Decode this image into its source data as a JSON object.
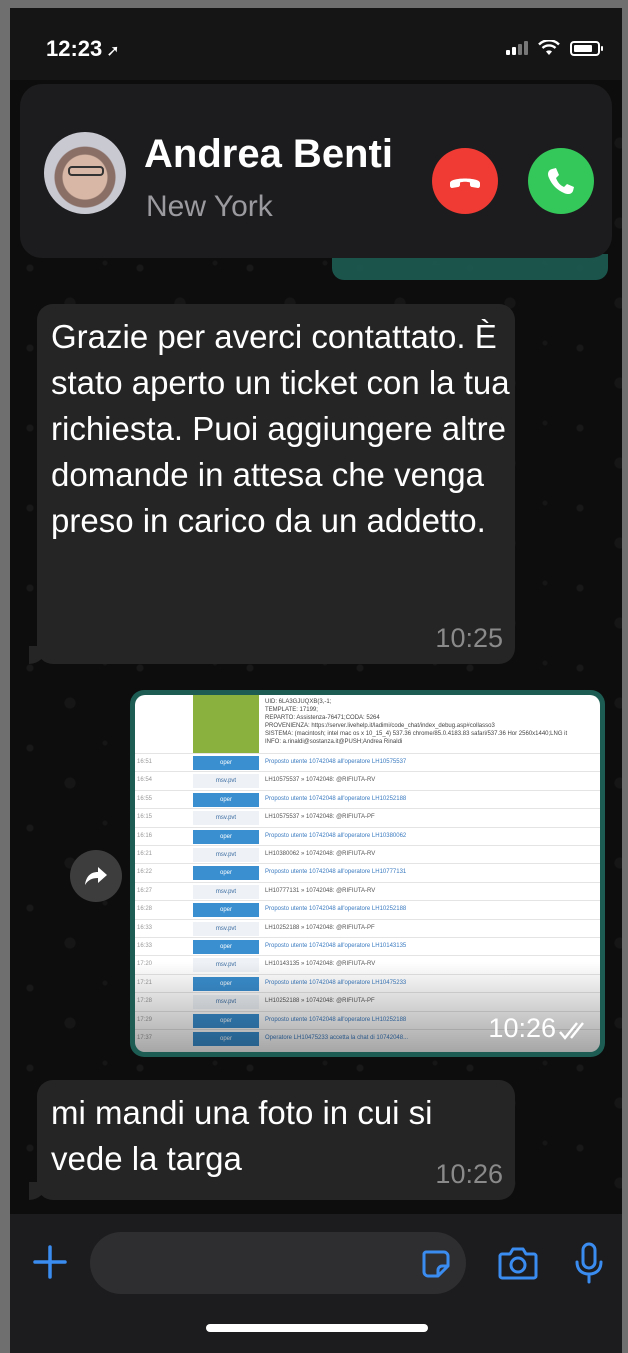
{
  "status_bar": {
    "time": "12:23",
    "location_glyph": "➚"
  },
  "call": {
    "caller_name": "Andrea Benti",
    "caller_location": "New York",
    "decline_icon": "phone-down-icon",
    "accept_icon": "phone-icon",
    "decline_color": "#ef3b33",
    "accept_color": "#34c759"
  },
  "prev_message": {
    "time": "10:25"
  },
  "messages": [
    {
      "text": "Grazie per averci contattato. È stato aperto un ticket con la tua richiesta. Puoi aggiungere altre domande in attesa che venga preso in carico da un addetto.",
      "time": "10:25"
    },
    {
      "text": "mi mandi una foto in cui si vede la targa",
      "time": "10:26"
    }
  ],
  "image_message": {
    "time": "10:26",
    "header_lines": [
      "UID: 6LA3GJUQXB(3,-1;",
      "TEMPLATE: 17199;",
      "REPARTO: Assistenza-76471;CODA: 5264",
      "PROVENIENZA: https://server.livehelp.it/ladimi/code_chat/index_debug.asp#collasso3",
      "SISTEMA: (macintosh; intel mac os x 10_15_4) 537.36 chrome/85.0.4183.83 safari/537.36 Hor 2560x1440;LNG it",
      "INFO: a.rinaldi@sostanza.it@PUSH;Andrea Rinaldi"
    ],
    "rows": [
      {
        "time": "16:51",
        "box": "oper",
        "text": "Proposto utente 10742048 all'operatore LH10575537"
      },
      {
        "time": "16:54",
        "box": "msv.pvt",
        "text": "LH10575537 » 10742048: @RIFIUTA-RV"
      },
      {
        "time": "16:55",
        "box": "oper",
        "text": "Proposto utente 10742048 all'operatore LH10252188"
      },
      {
        "time": "16:15",
        "box": "msv.pvt",
        "text": "LH10575537 » 10742048: @RIFIUTA-PF"
      },
      {
        "time": "16:16",
        "box": "oper",
        "text": "Proposto utente 10742048 all'operatore LH10380062"
      },
      {
        "time": "16:21",
        "box": "msv.pvt",
        "text": "LH10380062 » 10742048: @RIFIUTA-RV"
      },
      {
        "time": "16:22",
        "box": "oper",
        "text": "Proposto utente 10742048 all'operatore LH10777131"
      },
      {
        "time": "16:27",
        "box": "msv.pvt",
        "text": "LH10777131 » 10742048: @RIFIUTA-RV"
      },
      {
        "time": "16:28",
        "box": "oper",
        "text": "Proposto utente 10742048 all'operatore LH10252188"
      },
      {
        "time": "16:33",
        "box": "msv.pvt",
        "text": "LH10252188 » 10742048: @RIFIUTA-PF"
      },
      {
        "time": "16:33",
        "box": "oper",
        "text": "Proposto utente 10742048 all'operatore LH10143135"
      },
      {
        "time": "17:20",
        "box": "msv.pvt",
        "text": "LH10143135 » 10742048: @RIFIUTA-RV"
      },
      {
        "time": "17:21",
        "box": "oper",
        "text": "Proposto utente 10742048 all'operatore LH10475233"
      },
      {
        "time": "17:28",
        "box": "msv.pvt",
        "text": "LH10252188 » 10742048: @RIFIUTA-PF"
      },
      {
        "time": "17:29",
        "box": "oper",
        "text": "Proposto utente 10742048 all'operatore LH10252188"
      },
      {
        "time": "17:37",
        "box": "oper",
        "text": "Operatore LH10475233 accetta la chat di 10742048..."
      }
    ]
  },
  "input_bar": {
    "placeholder": ""
  },
  "colors": {
    "incoming_bubble": "#252525",
    "outgoing_bubble": "#1c5c52",
    "accent": "#3b8cf0"
  }
}
